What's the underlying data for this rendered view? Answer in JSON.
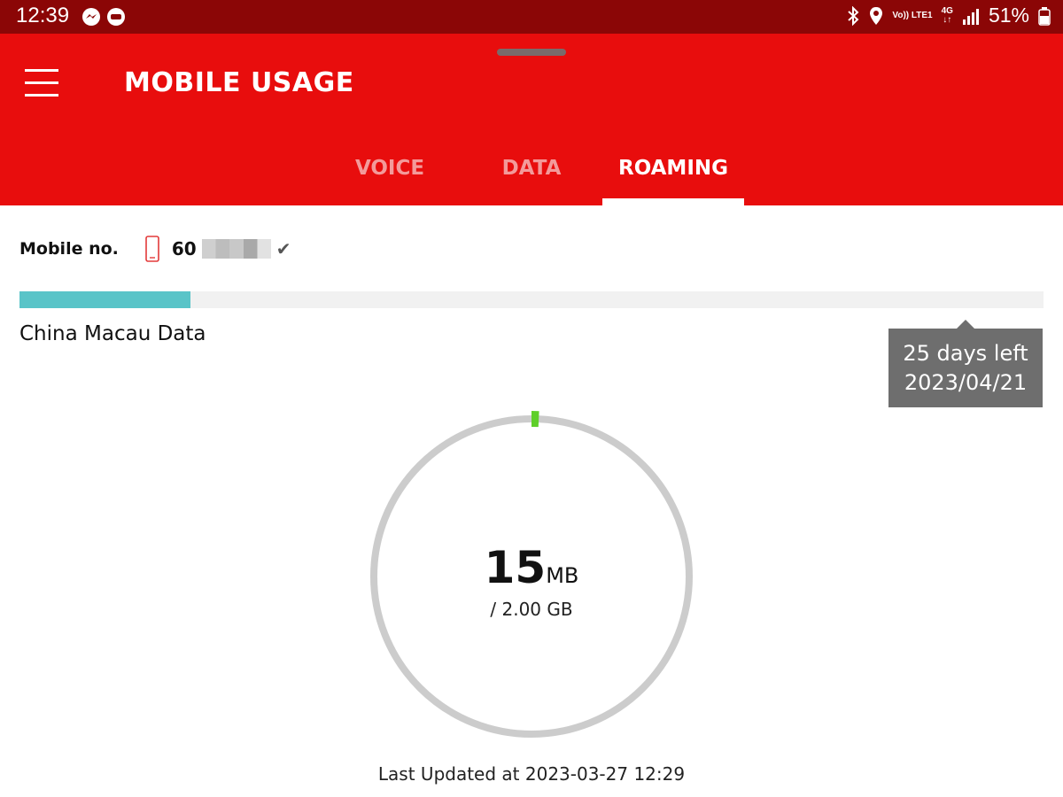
{
  "status_bar": {
    "time": "12:39",
    "battery": "51%",
    "network_top": "Vo)) LTE1",
    "network_gen": "4G",
    "left_icons": [
      "messenger-icon",
      "line-app-icon"
    ],
    "right_icons": [
      "bluetooth-icon",
      "location-icon",
      "signal-icon",
      "battery-icon"
    ]
  },
  "header": {
    "title": "MOBILE USAGE"
  },
  "tabs": [
    {
      "label": "VOICE",
      "active": false
    },
    {
      "label": "DATA",
      "active": false
    },
    {
      "label": "ROAMING",
      "active": true
    }
  ],
  "account": {
    "label": "Mobile no.",
    "number_prefix": "60"
  },
  "plan": {
    "name": "China Macau Data",
    "period_progress": 0.167,
    "days_left": "25 days left",
    "expiry_date": "2023/04/21"
  },
  "usage": {
    "used_value": "15",
    "used_unit": "MB",
    "total": "/ 2.00 GB",
    "used_fraction": 0.0073
  },
  "last_updated": "Last Updated at 2023-03-27 12:29",
  "colors": {
    "status_bar": "#8b0606",
    "brand_red": "#e80d0d",
    "progress": "#59c4c8",
    "gauge_track": "#cccccc",
    "gauge_used": "#5fcf2a"
  }
}
